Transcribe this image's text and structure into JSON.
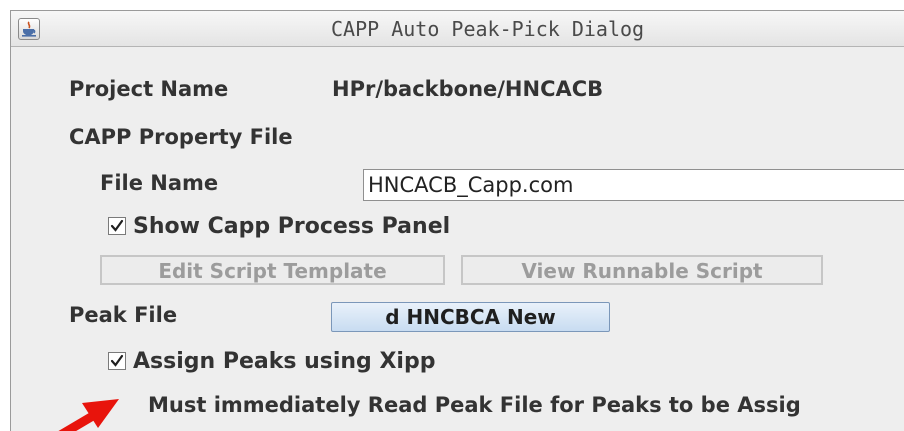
{
  "window": {
    "title": "CAPP Auto Peak-Pick Dialog"
  },
  "project": {
    "label": "Project Name",
    "value": "HPr/backbone/HNCACB"
  },
  "capp_property": {
    "section_label": "CAPP Property File",
    "file_name_label": "File Name",
    "file_name_value": "HNCACB_Capp.com",
    "show_process_panel": {
      "label": "Show Capp Process Panel",
      "checked": true
    },
    "edit_script_button": "Edit Script Template",
    "view_script_button": "View Runnable Script"
  },
  "peak_file": {
    "label": "Peak File",
    "button_label": "d HNCBCA New"
  },
  "assign": {
    "label": "Assign Peaks using Xipp",
    "checked": true,
    "warning": "Must immediately Read Peak File for Peaks to be Assig"
  },
  "annotation": {
    "arrow_color": "#e8140c"
  },
  "icons": {
    "app": "java-app-icon",
    "check": "checkmark-icon",
    "arrow": "red-arrow-icon"
  }
}
